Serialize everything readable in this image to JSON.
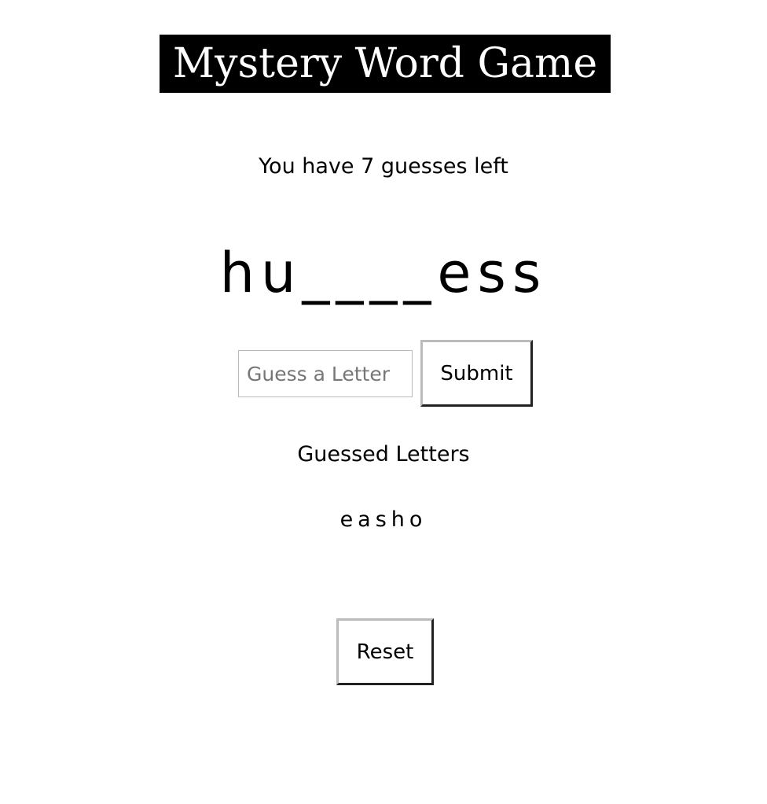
{
  "title": "Mystery Word Game",
  "guesses_remaining_text": "You have 7 guesses left",
  "guesses_remaining": 7,
  "word_progress": "hu____ess",
  "guess_input": {
    "value": "",
    "placeholder": "Guess a Letter"
  },
  "submit_label": "Submit",
  "guessed_letters_heading": "Guessed Letters",
  "guessed_letters": "easho",
  "reset_label": "Reset"
}
